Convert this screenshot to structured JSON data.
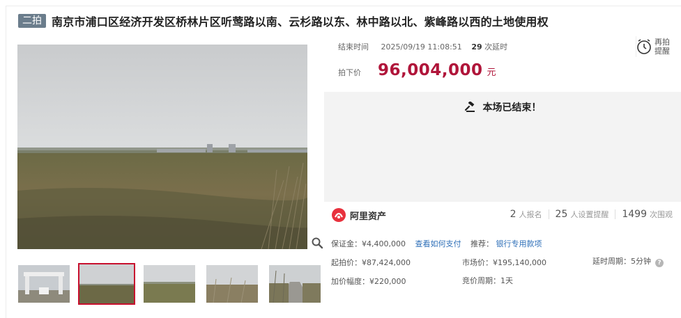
{
  "header": {
    "round_badge": "二拍",
    "title": "南京市浦口区经济开发区桥林片区听莺路以南、云杉路以东、林中路以北、紫峰路以西的土地使用权"
  },
  "auction": {
    "end_time_label": "结束时间",
    "end_time": "2025/09/19 11:08:51",
    "delay_count": "29",
    "delay_label": "次延时",
    "remind_label": "再拍提醒",
    "price_label": "拍下价",
    "final_price": "96,004,000",
    "price_unit": "元",
    "ended_message": "本场已结束！"
  },
  "platform": {
    "name": "阿里资产",
    "brand_color": "#e8313d"
  },
  "stats": {
    "registered_num": "2",
    "registered_label": "人报名",
    "reminders_num": "25",
    "reminders_label": "人设置提醒",
    "views_num": "1499",
    "views_label": "次围观"
  },
  "details": {
    "deposit": "保证金：¥4,400,000",
    "pay_link": "查看如何支付",
    "recommend_label": "推荐：",
    "bank_link": "银行专用款项",
    "start_price": "起拍价：¥87,424,000",
    "market_price": "市场价：¥195,140,000",
    "delay_period": "延时周期：5分钟",
    "increment": "加价幅度：¥220,000",
    "bid_period": "竞价周期：1天"
  },
  "colors": {
    "price": "#b0153a",
    "badge": "#6b7d8c",
    "link": "#2e6fb8",
    "active_thumb_border": "#c8102e",
    "ended_bg": "#f3f3f3"
  },
  "icons": {
    "zoom": "magnifier-icon",
    "remind": "alarm-clock-icon",
    "ended": "gavel-icon",
    "help": "question-icon"
  }
}
